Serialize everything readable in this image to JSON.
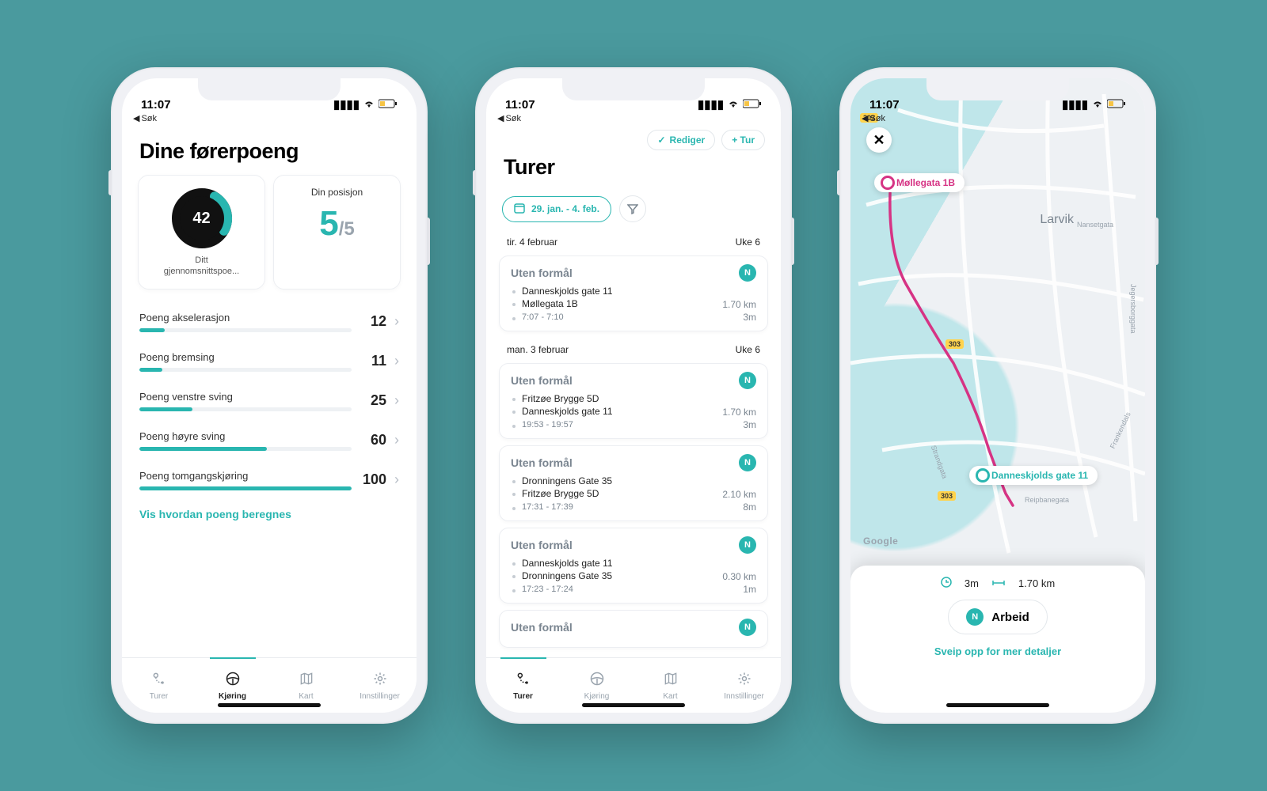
{
  "colors": {
    "accent": "#29b6b0",
    "pink": "#d63384"
  },
  "status": {
    "time": "11:07",
    "back": "Søk"
  },
  "phone1": {
    "title": "Dine førerpoeng",
    "gauge": {
      "value": "42",
      "percent": 25,
      "caption_line1": "Ditt",
      "caption_line2": "gjennomsnittspoe..."
    },
    "position": {
      "label": "Din posisjon",
      "value": "5",
      "of": "/5"
    },
    "metrics": [
      {
        "label": "Poeng akselerasjon",
        "value": "12"
      },
      {
        "label": "Poeng bremsing",
        "value": "11"
      },
      {
        "label": "Poeng venstre sving",
        "value": "25"
      },
      {
        "label": "Poeng høyre sving",
        "value": "60"
      },
      {
        "label": "Poeng tomgangskjøring",
        "value": "100"
      }
    ],
    "link": "Vis hvordan poeng beregnes",
    "tabs": [
      {
        "name": "turer",
        "label": "Turer"
      },
      {
        "name": "kjoring",
        "label": "Kjøring"
      },
      {
        "name": "kart",
        "label": "Kart"
      },
      {
        "name": "innstillinger",
        "label": "Innstillinger"
      }
    ],
    "active_tab": "kjoring"
  },
  "phone2": {
    "title": "Turer",
    "actions": {
      "edit": "Rediger",
      "add": "+ Tur"
    },
    "range": "29. jan. - 4. feb.",
    "days": [
      {
        "header": "tir. 4 februar",
        "week": "Uke 6",
        "trips": [
          {
            "purpose": "Uten formål",
            "badge": "N",
            "from": "Danneskjolds gate 11",
            "to": "Møllegata 1B",
            "time": "7:07 - 7:10",
            "distance": "1.70 km",
            "duration": "3m"
          }
        ]
      },
      {
        "header": "man. 3 februar",
        "week": "Uke 6",
        "trips": [
          {
            "purpose": "Uten formål",
            "badge": "N",
            "from": "Fritzøe Brygge 5D",
            "to": "Danneskjolds gate 11",
            "time": "19:53 - 19:57",
            "distance": "1.70 km",
            "duration": "3m"
          },
          {
            "purpose": "Uten formål",
            "badge": "N",
            "from": "Dronningens Gate 35",
            "to": "Fritzøe Brygge 5D",
            "time": "17:31 - 17:39",
            "distance": "2.10 km",
            "duration": "8m"
          },
          {
            "purpose": "Uten formål",
            "badge": "N",
            "from": "Danneskjolds gate 11",
            "to": "Dronningens Gate 35",
            "time": "17:23 - 17:24",
            "distance": "0.30 km",
            "duration": "1m"
          },
          {
            "purpose": "Uten formål",
            "badge": "N",
            "from": "",
            "to": "",
            "time": "",
            "distance": "",
            "duration": ""
          }
        ]
      }
    ],
    "active_tab": "turer"
  },
  "phone3": {
    "city": "Larvik",
    "roads": [
      "303",
      "303",
      "303"
    ],
    "streets": [
      "Nansetgata",
      "Jegersborggata",
      "Strandgata",
      "Reipbanegata",
      "Frankendals"
    ],
    "start_label": "Møllegata 1B",
    "end_label": "Danneskjolds gate 11",
    "google": "Google",
    "sheet": {
      "duration": "3m",
      "distance": "1.70 km",
      "work_badge": "N",
      "work_label": "Arbeid",
      "hint": "Sveip opp for mer detaljer"
    }
  }
}
